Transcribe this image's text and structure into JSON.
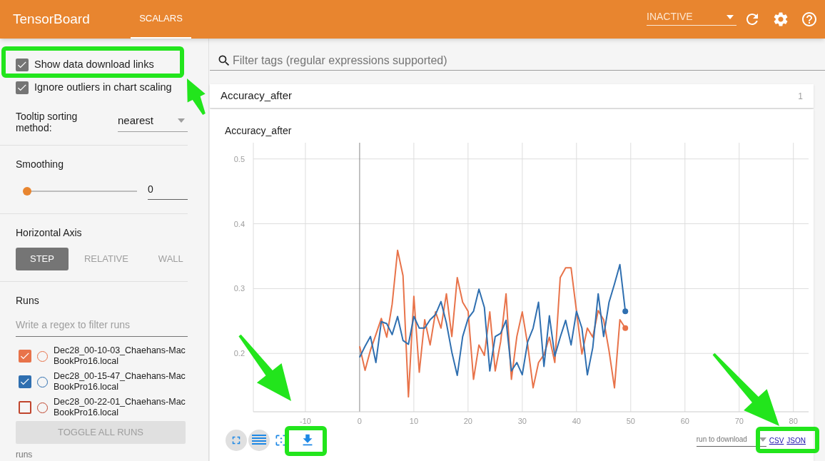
{
  "header": {
    "title": "TensorBoard",
    "tabs": [
      {
        "label": "SCALARS",
        "selected": true
      }
    ],
    "reload_select": {
      "value": "INACTIVE"
    }
  },
  "sidebar": {
    "options": [
      {
        "label": "Show data download links",
        "checked": true
      },
      {
        "label": "Ignore outliers in chart scaling",
        "checked": true
      }
    ],
    "tooltip_sorting": {
      "label": "Tooltip sorting method:",
      "value": "nearest"
    },
    "smoothing": {
      "title": "Smoothing",
      "level": 0,
      "value": "0"
    },
    "horizontal_axis": {
      "title": "Horizontal Axis",
      "options": [
        {
          "label": "STEP",
          "selected": true
        },
        {
          "label": "RELATIVE",
          "selected": false
        },
        {
          "label": "WALL",
          "selected": false
        }
      ]
    },
    "runs": {
      "title": "Runs",
      "filter_placeholder": "Write a regex to filter runs",
      "items": [
        {
          "name": "Dec28_00-10-03_Chaehans-MacBookPro16.local",
          "checked": true,
          "color": "#e8734a",
          "selected": false
        },
        {
          "name": "Dec28_00-15-47_Chaehans-MacBookPro16.local",
          "checked": true,
          "color": "#2f6fb0",
          "selected": false
        },
        {
          "name": "Dec28_00-22-01_Chaehans-MacBookPro16.local",
          "checked": false,
          "color": "#c0452d",
          "selected": false
        }
      ],
      "toggle_button": "TOGGLE ALL RUNS",
      "footer": "runs"
    }
  },
  "main": {
    "filter_placeholder": "Filter tags (regular expressions supported)",
    "category": {
      "title": "Accuracy_after",
      "count": "1"
    },
    "card": {
      "chart_data": {
        "type": "line",
        "title": "Accuracy_after",
        "x": [
          0,
          1,
          2,
          3,
          4,
          5,
          6,
          7,
          8,
          9,
          10,
          11,
          12,
          13,
          14,
          15,
          16,
          17,
          18,
          19,
          20,
          21,
          22,
          23,
          24,
          25,
          26,
          27,
          28,
          29,
          30,
          31,
          32,
          33,
          34,
          35,
          36,
          37,
          38,
          39,
          40,
          41,
          42,
          43,
          44,
          45,
          46,
          47,
          48,
          49
        ],
        "series": [
          {
            "color": "#e8734a",
            "values": [
              0.211,
              0.174,
              0.205,
              0.229,
              0.254,
              0.225,
              0.276,
              0.359,
              0.32,
              0.133,
              0.288,
              0.171,
              0.252,
              0.213,
              0.264,
              0.239,
              0.292,
              0.226,
              0.317,
              0.279,
              0.265,
              0.16,
              0.213,
              0.197,
              0.264,
              0.173,
              0.218,
              0.292,
              0.16,
              0.226,
              0.264,
              0.213,
              0.147,
              0.186,
              0.198,
              0.225,
              0.186,
              0.317,
              0.332,
              0.332,
              0.265,
              0.199,
              0.239,
              0.225,
              0.266,
              0.252,
              0.204,
              0.147,
              0.252,
              0.239
            ]
          },
          {
            "color": "#2f6fb0",
            "values": [
              0.194,
              0.211,
              0.226,
              0.186,
              0.249,
              0.246,
              0.229,
              0.257,
              0.22,
              0.214,
              0.257,
              0.239,
              0.239,
              0.252,
              0.26,
              0.28,
              0.247,
              0.202,
              0.166,
              0.226,
              0.254,
              0.265,
              0.299,
              0.271,
              0.173,
              0.226,
              0.231,
              0.251,
              0.173,
              0.186,
              0.167,
              0.218,
              0.239,
              0.279,
              0.18,
              0.258,
              0.196,
              0.225,
              0.251,
              0.213,
              0.265,
              0.239,
              0.167,
              0.209,
              0.292,
              0.226,
              0.279,
              0.307,
              0.337,
              0.265
            ]
          }
        ],
        "xlim": [
          -19.6,
          82.8
        ],
        "ylim": [
          0.11,
          0.525
        ],
        "xticks": [
          -10,
          0,
          10,
          20,
          30,
          40,
          50,
          60,
          70,
          80
        ],
        "yticks": [
          0.2,
          0.3,
          0.4,
          0.5
        ],
        "grid": true
      },
      "run_select_label": "run to download",
      "links": [
        "CSV",
        "JSON"
      ]
    }
  }
}
